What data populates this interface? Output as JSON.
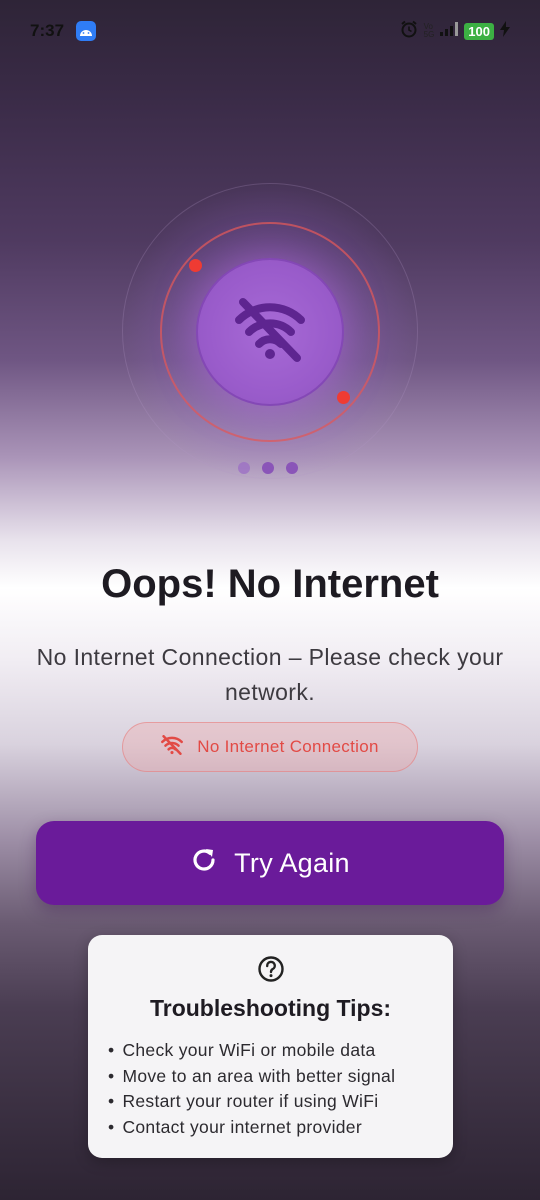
{
  "status_bar": {
    "time": "7:37",
    "battery": "100",
    "network_label_top": "Vo",
    "network_label_bottom": "5G"
  },
  "hero": {
    "icon": "wifi-off-icon",
    "loading_dots": 3
  },
  "main": {
    "title": "Oops! No Internet",
    "subtitle": "No Internet Connection – Please check your network.",
    "status_chip": "No Internet Connection",
    "retry_button": "Try Again"
  },
  "tips": {
    "icon": "help-circle-icon",
    "title": "Troubleshooting Tips:",
    "items": [
      "Check your WiFi or mobile data",
      "Move to an area with better signal",
      "Restart your router if using WiFi",
      "Contact your internet provider"
    ]
  },
  "colors": {
    "accent": "#6a1b9a",
    "error": "#e24a45",
    "hero_circle": "#9a5ccb"
  }
}
